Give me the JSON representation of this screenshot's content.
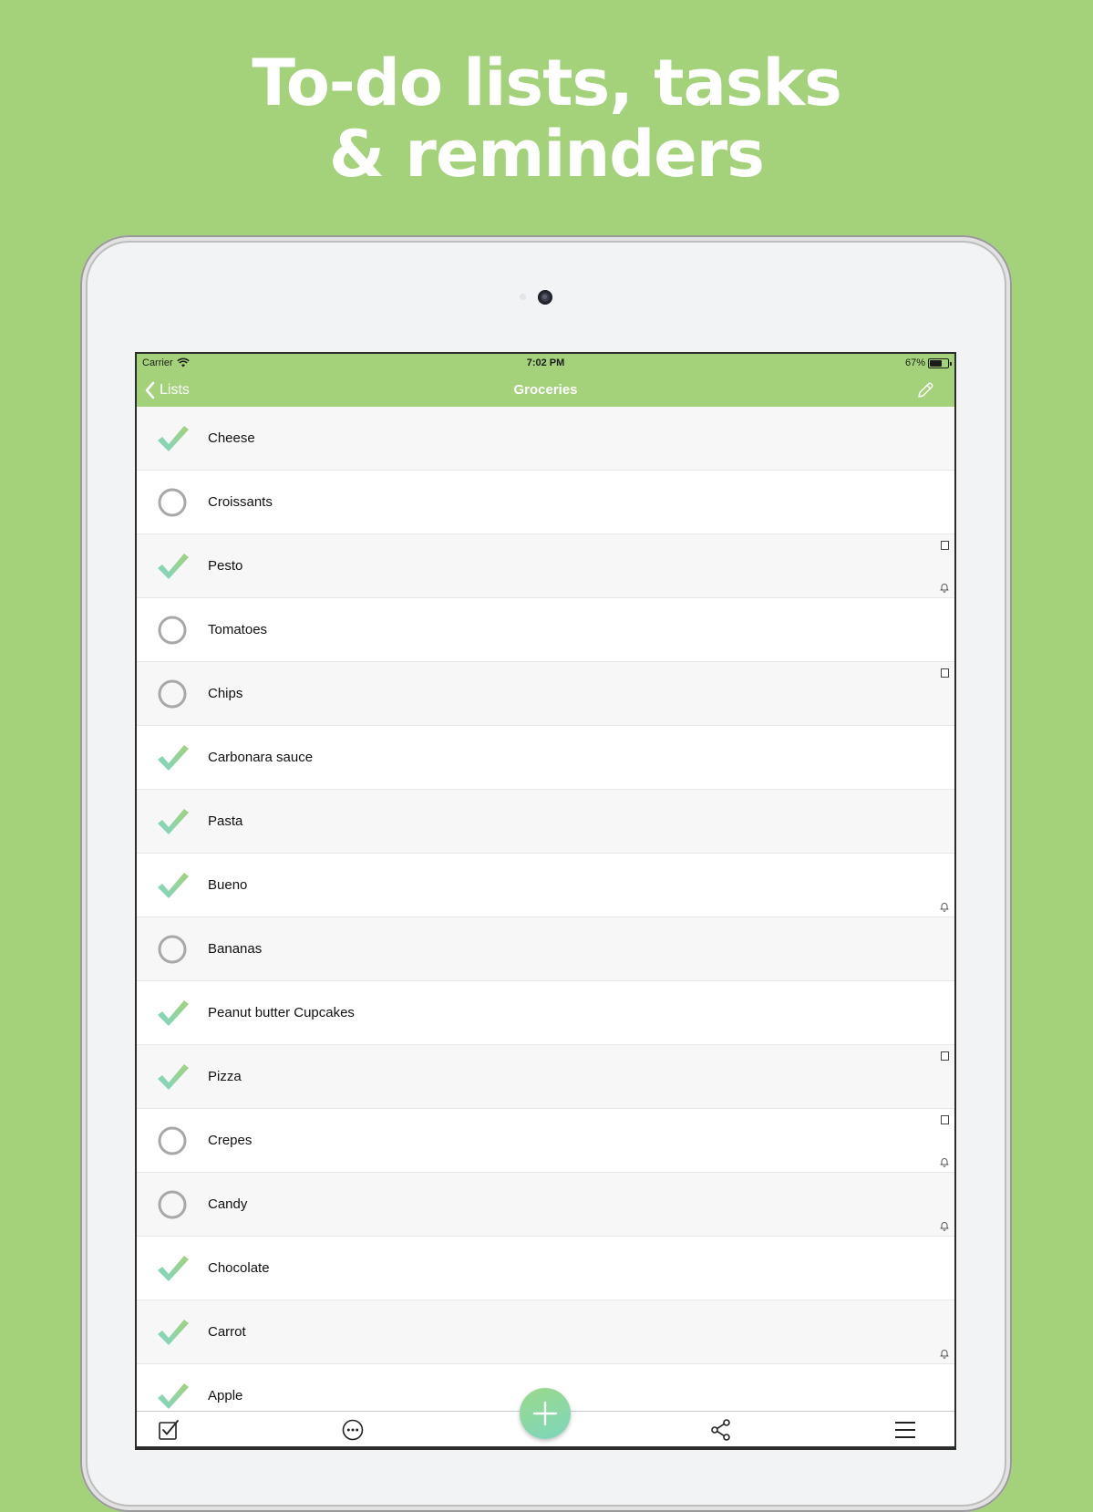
{
  "headline": {
    "line1": "To-do lists, tasks",
    "line2": "& reminders"
  },
  "status_bar": {
    "carrier": "Carrier",
    "time": "7:02 PM",
    "battery": "67%",
    "icons": [
      "wifi-icon",
      "battery-icon"
    ]
  },
  "nav": {
    "back_label": "Lists",
    "title": "Groceries",
    "edit_icon": "pencil-icon"
  },
  "items": [
    {
      "label": "Cheese",
      "checked": true,
      "note": false,
      "reminder": false
    },
    {
      "label": "Croissants",
      "checked": false,
      "note": false,
      "reminder": false
    },
    {
      "label": "Pesto",
      "checked": true,
      "note": true,
      "reminder": true
    },
    {
      "label": "Tomatoes",
      "checked": false,
      "note": false,
      "reminder": false
    },
    {
      "label": "Chips",
      "checked": false,
      "note": true,
      "reminder": false
    },
    {
      "label": "Carbonara sauce",
      "checked": true,
      "note": false,
      "reminder": false
    },
    {
      "label": "Pasta",
      "checked": true,
      "note": false,
      "reminder": false
    },
    {
      "label": "Bueno",
      "checked": true,
      "note": false,
      "reminder": true
    },
    {
      "label": "Bananas",
      "checked": false,
      "note": false,
      "reminder": false
    },
    {
      "label": "Peanut butter Cupcakes",
      "checked": true,
      "note": false,
      "reminder": false
    },
    {
      "label": "Pizza",
      "checked": true,
      "note": true,
      "reminder": false
    },
    {
      "label": "Crepes",
      "checked": false,
      "note": true,
      "reminder": true
    },
    {
      "label": "Candy",
      "checked": false,
      "note": false,
      "reminder": true
    },
    {
      "label": "Chocolate",
      "checked": true,
      "note": false,
      "reminder": false
    },
    {
      "label": "Carrot",
      "checked": true,
      "note": false,
      "reminder": true
    },
    {
      "label": "Apple",
      "checked": true,
      "note": false,
      "reminder": false
    }
  ],
  "tabbar": {
    "icons": [
      "checklist-icon",
      "more-icon",
      "add-icon",
      "share-icon",
      "menu-icon"
    ]
  },
  "colors": {
    "accent": "#a3d27b",
    "check_start": "#7fd6c6",
    "check_end": "#a3d27b",
    "circle": "#a8a8a8"
  }
}
